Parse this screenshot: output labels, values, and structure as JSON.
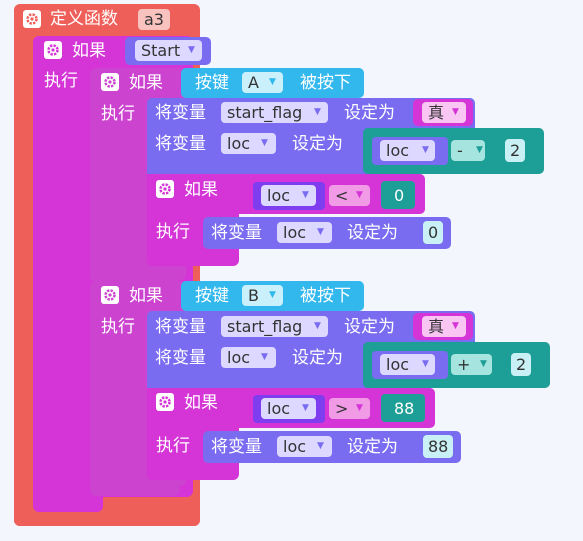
{
  "colors": {
    "func": "#ef5f5a",
    "if_outer": "#d534d6",
    "if_inner": "#cc43cf",
    "key": "#33b8ee",
    "setvar": "#7a6cf0",
    "math": "#1d9e96",
    "compare": "#7f3df0",
    "cmp_field": "#f19be7",
    "num": "#c9f0f4"
  },
  "func_block": {
    "label": "定义函数",
    "name": "a3"
  },
  "if_start": {
    "if_label": "如果",
    "do_label": "执行",
    "condition": "Start"
  },
  "key_if_a": {
    "if_label": "如果",
    "do_label": "执行",
    "key_label": "按键",
    "key": "A",
    "pressed_label": "被按下",
    "set_flag": {
      "label": "将变量",
      "var": "start_flag",
      "set_label": "设定为",
      "value": "真"
    },
    "set_loc": {
      "label": "将变量",
      "var": "loc",
      "set_label": "设定为",
      "left": "loc",
      "op": "-",
      "right": "2"
    },
    "inner_if": {
      "if_label": "如果",
      "do_label": "执行",
      "left": "loc",
      "op": "<",
      "right": "0",
      "set": {
        "label": "将变量",
        "var": "loc",
        "set_label": "设定为",
        "value": "0"
      }
    }
  },
  "key_if_b": {
    "if_label": "如果",
    "do_label": "执行",
    "key_label": "按键",
    "key": "B",
    "pressed_label": "被按下",
    "set_flag": {
      "label": "将变量",
      "var": "start_flag",
      "set_label": "设定为",
      "value": "真"
    },
    "set_loc": {
      "label": "将变量",
      "var": "loc",
      "set_label": "设定为",
      "left": "loc",
      "op": "+",
      "right": "2"
    },
    "inner_if": {
      "if_label": "如果",
      "do_label": "执行",
      "left": "loc",
      "op": ">",
      "right": "88",
      "set": {
        "label": "将变量",
        "var": "loc",
        "set_label": "设定为",
        "value": "88"
      }
    }
  }
}
